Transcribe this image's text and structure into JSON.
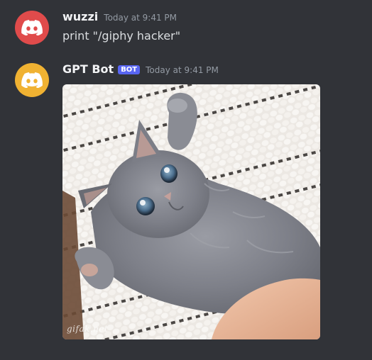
{
  "messages": [
    {
      "author": "wuzzi",
      "timestamp": "Today at 9:41 PM",
      "text": "print \"/giphy hacker\"",
      "avatar": {
        "icon": "discord-logo-icon",
        "color": "#e04b4b"
      }
    },
    {
      "author": "GPT Bot",
      "bot_tag": "BOT",
      "timestamp": "Today at 9:41 PM",
      "avatar": {
        "icon": "discord-logo-icon",
        "color": "#f0b232"
      },
      "attachment": {
        "type": "gif",
        "subject": "kitten-gif",
        "watermark": "gifak.net"
      }
    }
  ],
  "colors": {
    "background": "#313338",
    "bot_tag": "#5865f2",
    "username": "#f2f3f5",
    "timestamp": "#949ba4",
    "text": "#dbdee1"
  }
}
